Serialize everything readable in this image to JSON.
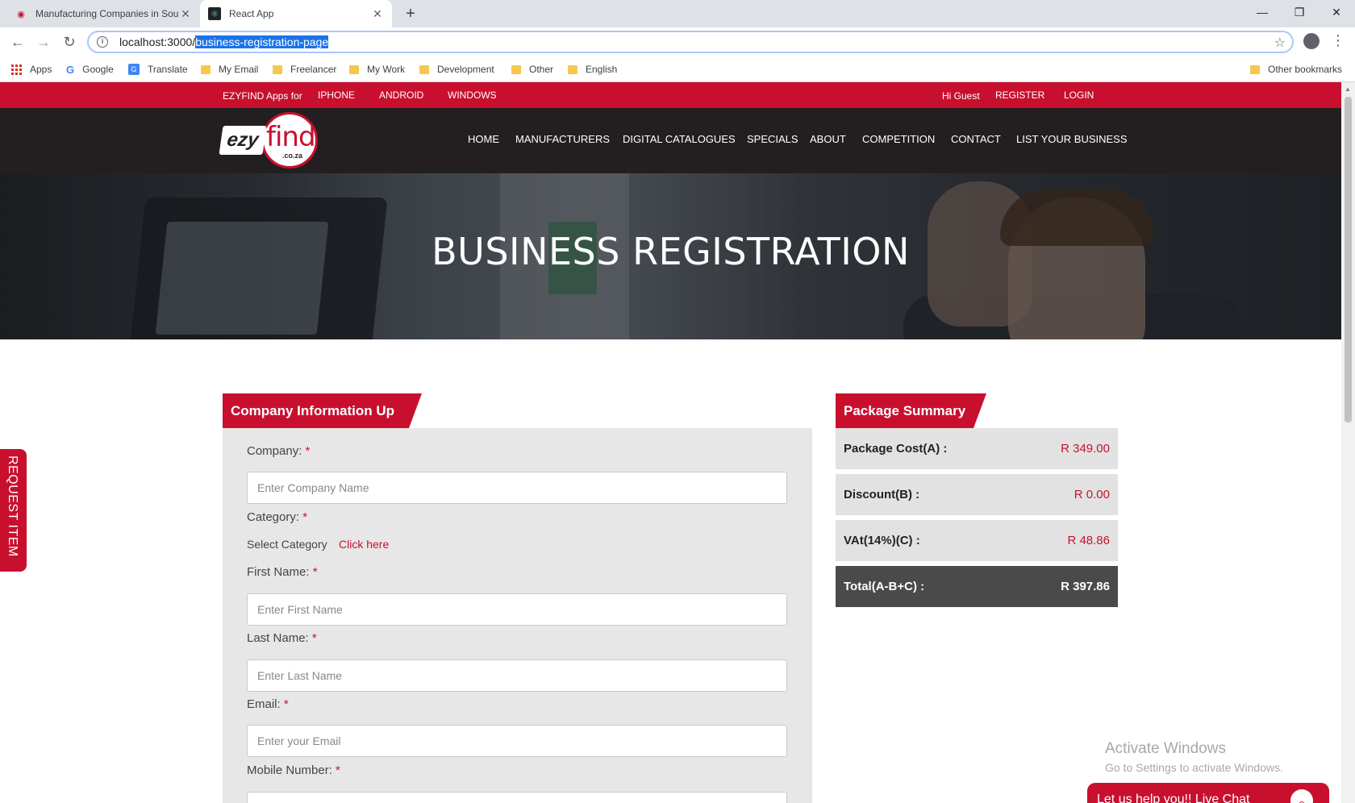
{
  "browser": {
    "tabs": [
      {
        "title": "Manufacturing Companies in Sou",
        "active": false
      },
      {
        "title": "React App",
        "active": true
      }
    ],
    "url_host": "localhost:3000/",
    "url_path": "business-registration-page",
    "bookmarks": [
      "Apps",
      "Google",
      "Translate",
      "My Email",
      "Freelancer",
      "My Work",
      "Development",
      "Other",
      "English"
    ],
    "other_bookmarks": "Other bookmarks"
  },
  "topbar": {
    "apps_for": "EZYFIND Apps for",
    "platforms": [
      "IPHONE",
      "ANDROID",
      "WINDOWS"
    ],
    "greeting": "Hi Guest",
    "register": "REGISTER",
    "login": "LOGIN"
  },
  "logo": {
    "ezy": "ezy",
    "find": "find",
    "domain": ".co.za"
  },
  "nav": [
    "HOME",
    "MANUFACTURERS",
    "DIGITAL CATALOGUES",
    "SPECIALS",
    "ABOUT",
    "COMPETITION",
    "CONTACT",
    "LIST YOUR BUSINESS"
  ],
  "hero": {
    "title": "BUSINESS REGISTRATION"
  },
  "form": {
    "heading": "Company Information Up",
    "required_mark": "*",
    "company_label": "Company:",
    "company_placeholder": "Enter Company Name",
    "category_label": "Category:",
    "select_category": "Select Category",
    "click_here": "Click here",
    "first_name_label": "First Name:",
    "first_name_placeholder": "Enter First Name",
    "last_name_label": "Last Name:",
    "last_name_placeholder": "Enter Last Name",
    "email_label": "Email:",
    "email_placeholder": "Enter your Email",
    "mobile_label": "Mobile Number:"
  },
  "summary": {
    "heading": "Package Summary",
    "rows": [
      {
        "label": "Package Cost(A) :",
        "value": "R 349.00"
      },
      {
        "label": "Discount(B) :",
        "value": "R 0.00"
      },
      {
        "label": "VAt(14%)(C) :",
        "value": "R 48.86"
      },
      {
        "label": "Total(A-B+C) :",
        "value": "R 397.86"
      }
    ]
  },
  "side_tab": "REQUEST ITEM",
  "watermark": {
    "title": "Activate Windows",
    "subtitle": "Go to Settings to activate Windows."
  },
  "chat": {
    "label": "Let us help you!! Live Chat"
  },
  "colors": {
    "brand_red": "#c8102e",
    "nav_dark": "#231f20"
  }
}
